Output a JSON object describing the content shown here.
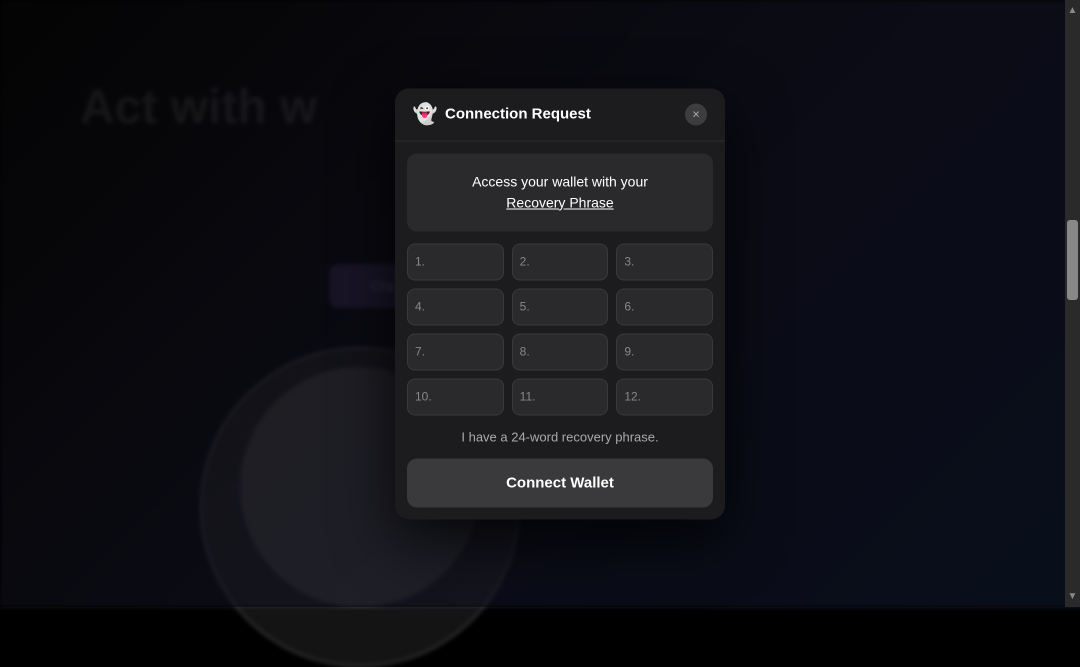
{
  "background": {
    "text": "Act with w"
  },
  "modal": {
    "icon": "👻",
    "title": "Connection Request",
    "close_label": "×",
    "recovery_header": {
      "line1": "Access your wallet with your",
      "line2": "Recovery Phrase"
    },
    "inputs": [
      {
        "label": "1.",
        "placeholder": ""
      },
      {
        "label": "2.",
        "placeholder": ""
      },
      {
        "label": "3.",
        "placeholder": ""
      },
      {
        "label": "4.",
        "placeholder": ""
      },
      {
        "label": "5.",
        "placeholder": ""
      },
      {
        "label": "6.",
        "placeholder": ""
      },
      {
        "label": "7.",
        "placeholder": ""
      },
      {
        "label": "8.",
        "placeholder": ""
      },
      {
        "label": "9.",
        "placeholder": ""
      },
      {
        "label": "10.",
        "placeholder": ""
      },
      {
        "label": "11.",
        "placeholder": ""
      },
      {
        "label": "12.",
        "placeholder": ""
      }
    ],
    "twenty_four_text": "I have a 24-word recovery phrase.",
    "connect_button": "Connect Wallet"
  }
}
